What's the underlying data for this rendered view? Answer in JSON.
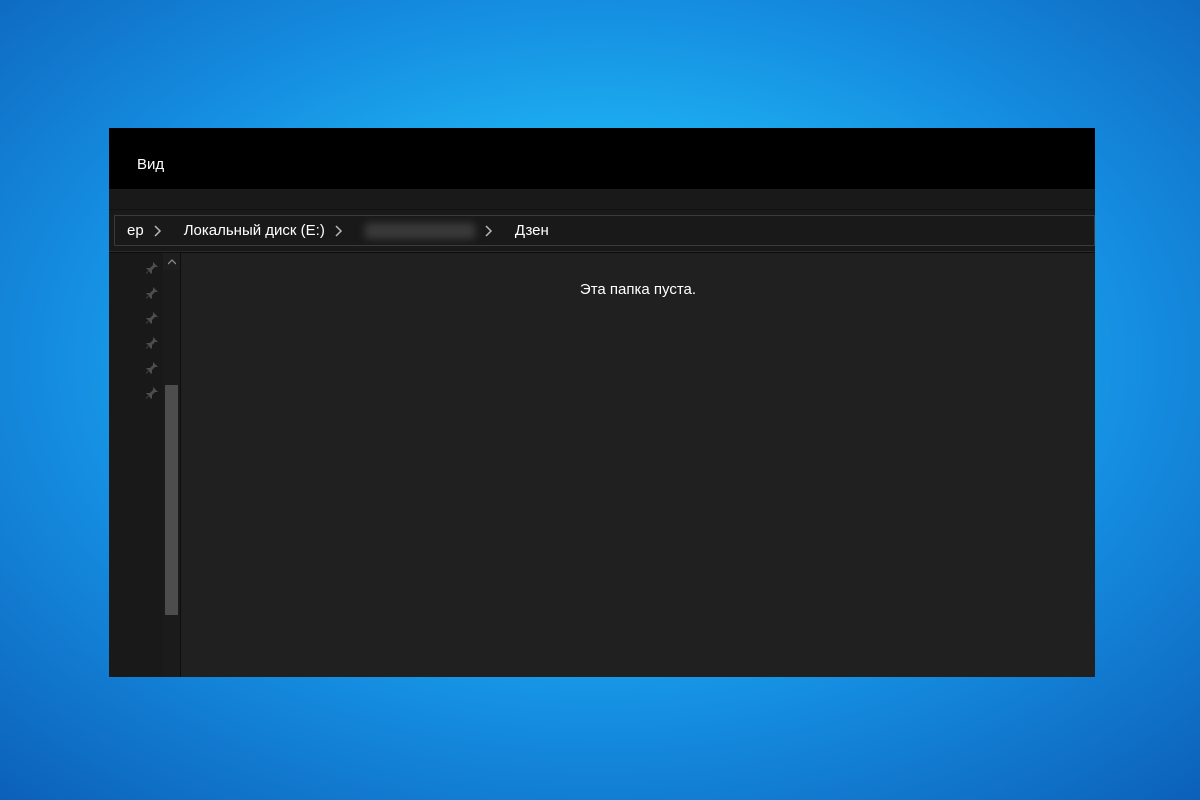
{
  "menu": {
    "view_label": "Вид"
  },
  "breadcrumb": {
    "partial_first": "ер",
    "local_disk": "Локальный диск (E:)",
    "obscured_segment": "",
    "current": "Дзен"
  },
  "content": {
    "empty_message": "Эта папка пуста."
  },
  "sidebar": {
    "pin_count": 6
  }
}
